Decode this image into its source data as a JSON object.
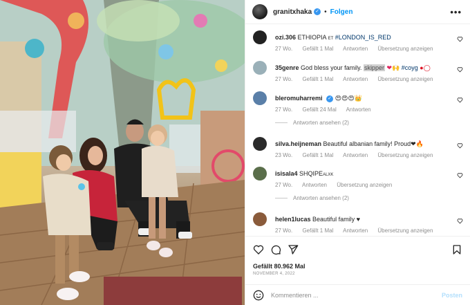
{
  "post": {
    "username": "granitxhaka",
    "separator": "•",
    "follow_label": "Folgen",
    "more_label": "•••"
  },
  "comments": [
    {
      "user": "ozi.306",
      "text_a": "ETHIOPIA",
      "text_small": "ET",
      "text_tag": "#LONDON_IS_RED",
      "age": "27 Wo.",
      "likes": "Gefällt 1 Mal",
      "reply": "Antworten",
      "translate": "Übersetzung anzeigen"
    },
    {
      "user": "35genre",
      "text_a": "God bless your family.",
      "text_hl": "skipper",
      "text_emoji": "❤🙌",
      "text_tag": "#coyg",
      "text_end": "●◯",
      "age": "27 Wo.",
      "likes": "Gefällt 1 Mal",
      "reply": "Antworten",
      "translate": "Übersetzung anzeigen"
    },
    {
      "user": "bleromuharremi",
      "text_a": "😍😍😍👑",
      "age": "27 Wo.",
      "likes": "Gefällt 24 Mal",
      "reply": "Antworten",
      "view_replies": "Antworten ansehen (2)"
    },
    {
      "user": "silva.heijneman",
      "text_a": "Beautiful albanian family! Proud❤🔥",
      "age": "23 Wo.",
      "likes": "Gefällt 1 Mal",
      "reply": "Antworten",
      "translate": "Übersetzung anzeigen"
    },
    {
      "user": "isisala4",
      "text_a": "SHQIPE",
      "text_small": "ALXK",
      "age": "27 Wo.",
      "reply": "Antworten",
      "translate": "Übersetzung anzeigen",
      "view_replies": "Antworten ansehen (2)"
    },
    {
      "user": "helen1lucas",
      "text_a": "Beautiful family ♥",
      "age": "27 Wo.",
      "likes": "Gefällt 1 Mal",
      "reply": "Antworten",
      "translate": "Übersetzung anzeigen"
    }
  ],
  "footer": {
    "likes": "Gefällt 80.962 Mal",
    "date": "NOVEMBER 4, 2022",
    "comment_placeholder": "Kommentieren ...",
    "post_label": "Posten"
  },
  "colors": {
    "link": "#0095f6",
    "tag": "#00376b",
    "verified": "#3897f0",
    "meta": "#8e8e8e"
  },
  "icons": [
    "verified-badge-icon",
    "heart-icon",
    "comment-icon",
    "share-icon",
    "bookmark-icon",
    "emoji-icon"
  ]
}
